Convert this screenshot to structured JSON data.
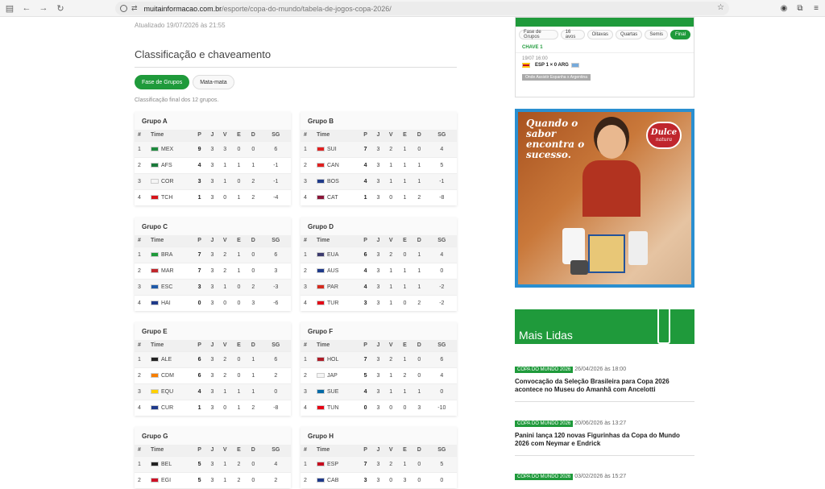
{
  "browser": {
    "url_host": "muitainformacao.com.br",
    "url_path": "/esporte/copa-do-mundo/tabela-de-jogos-copa-2026/"
  },
  "updated": "Atualizado 19/07/2026 às 21:55",
  "section_title": "Classificação e chaveamento",
  "toggle": {
    "groups_label": "Fase de Grupos",
    "knockout_label": "Mata-mata"
  },
  "subtext": "Classificação final dos 12 grupos.",
  "table_headers": {
    "pos": "#",
    "team": "Time",
    "p": "P",
    "j": "J",
    "v": "V",
    "e": "E",
    "d": "D",
    "sg": "SG"
  },
  "groups": [
    {
      "title": "Grupo A",
      "rows": [
        {
          "pos": "1",
          "team": "MEX",
          "p": "9",
          "j": "3",
          "v": "3",
          "e": "0",
          "d": "0",
          "sg": "6"
        },
        {
          "pos": "2",
          "team": "AFS",
          "p": "4",
          "j": "3",
          "v": "1",
          "e": "1",
          "d": "1",
          "sg": "-1"
        },
        {
          "pos": "3",
          "team": "COR",
          "p": "3",
          "j": "3",
          "v": "1",
          "e": "0",
          "d": "2",
          "sg": "-1"
        },
        {
          "pos": "4",
          "team": "TCH",
          "p": "1",
          "j": "3",
          "v": "0",
          "e": "1",
          "d": "2",
          "sg": "-4"
        }
      ]
    },
    {
      "title": "Grupo B",
      "rows": [
        {
          "pos": "1",
          "team": "SUI",
          "p": "7",
          "j": "3",
          "v": "2",
          "e": "1",
          "d": "0",
          "sg": "4"
        },
        {
          "pos": "2",
          "team": "CAN",
          "p": "4",
          "j": "3",
          "v": "1",
          "e": "1",
          "d": "1",
          "sg": "5"
        },
        {
          "pos": "3",
          "team": "BOS",
          "p": "4",
          "j": "3",
          "v": "1",
          "e": "1",
          "d": "1",
          "sg": "-1"
        },
        {
          "pos": "4",
          "team": "CAT",
          "p": "1",
          "j": "3",
          "v": "0",
          "e": "1",
          "d": "2",
          "sg": "-8"
        }
      ]
    },
    {
      "title": "Grupo C",
      "rows": [
        {
          "pos": "1",
          "team": "BRA",
          "p": "7",
          "j": "3",
          "v": "2",
          "e": "1",
          "d": "0",
          "sg": "6"
        },
        {
          "pos": "2",
          "team": "MAR",
          "p": "7",
          "j": "3",
          "v": "2",
          "e": "1",
          "d": "0",
          "sg": "3"
        },
        {
          "pos": "3",
          "team": "ESC",
          "p": "3",
          "j": "3",
          "v": "1",
          "e": "0",
          "d": "2",
          "sg": "-3"
        },
        {
          "pos": "4",
          "team": "HAI",
          "p": "0",
          "j": "3",
          "v": "0",
          "e": "0",
          "d": "3",
          "sg": "-6"
        }
      ]
    },
    {
      "title": "Grupo D",
      "rows": [
        {
          "pos": "1",
          "team": "EUA",
          "p": "6",
          "j": "3",
          "v": "2",
          "e": "0",
          "d": "1",
          "sg": "4"
        },
        {
          "pos": "2",
          "team": "AUS",
          "p": "4",
          "j": "3",
          "v": "1",
          "e": "1",
          "d": "1",
          "sg": "0"
        },
        {
          "pos": "3",
          "team": "PAR",
          "p": "4",
          "j": "3",
          "v": "1",
          "e": "1",
          "d": "1",
          "sg": "-2"
        },
        {
          "pos": "4",
          "team": "TUR",
          "p": "3",
          "j": "3",
          "v": "1",
          "e": "0",
          "d": "2",
          "sg": "-2"
        }
      ]
    },
    {
      "title": "Grupo E",
      "rows": [
        {
          "pos": "1",
          "team": "ALE",
          "p": "6",
          "j": "3",
          "v": "2",
          "e": "0",
          "d": "1",
          "sg": "6"
        },
        {
          "pos": "2",
          "team": "CDM",
          "p": "6",
          "j": "3",
          "v": "2",
          "e": "0",
          "d": "1",
          "sg": "2"
        },
        {
          "pos": "3",
          "team": "EQU",
          "p": "4",
          "j": "3",
          "v": "1",
          "e": "1",
          "d": "1",
          "sg": "0"
        },
        {
          "pos": "4",
          "team": "CUR",
          "p": "1",
          "j": "3",
          "v": "0",
          "e": "1",
          "d": "2",
          "sg": "-8"
        }
      ]
    },
    {
      "title": "Grupo F",
      "rows": [
        {
          "pos": "1",
          "team": "HOL",
          "p": "7",
          "j": "3",
          "v": "2",
          "e": "1",
          "d": "0",
          "sg": "6"
        },
        {
          "pos": "2",
          "team": "JAP",
          "p": "5",
          "j": "3",
          "v": "1",
          "e": "2",
          "d": "0",
          "sg": "4"
        },
        {
          "pos": "3",
          "team": "SUE",
          "p": "4",
          "j": "3",
          "v": "1",
          "e": "1",
          "d": "1",
          "sg": "0"
        },
        {
          "pos": "4",
          "team": "TUN",
          "p": "0",
          "j": "3",
          "v": "0",
          "e": "0",
          "d": "3",
          "sg": "-10"
        }
      ]
    },
    {
      "title": "Grupo G",
      "rows": [
        {
          "pos": "1",
          "team": "BEL",
          "p": "5",
          "j": "3",
          "v": "1",
          "e": "2",
          "d": "0",
          "sg": "4"
        },
        {
          "pos": "2",
          "team": "EGI",
          "p": "5",
          "j": "3",
          "v": "1",
          "e": "2",
          "d": "0",
          "sg": "2"
        }
      ]
    },
    {
      "title": "Grupo H",
      "rows": [
        {
          "pos": "1",
          "team": "ESP",
          "p": "7",
          "j": "3",
          "v": "2",
          "e": "1",
          "d": "0",
          "sg": "5"
        },
        {
          "pos": "2",
          "team": "CAB",
          "p": "3",
          "j": "3",
          "v": "0",
          "e": "3",
          "d": "0",
          "sg": "0"
        }
      ]
    }
  ],
  "flag_colors": {
    "MEX": "#1e8a3e",
    "AFS": "#1a7a3a",
    "COR": "#f5f5f5",
    "TCH": "#d7141a",
    "SUI": "#e02020",
    "CAN": "#e02020",
    "BOS": "#1f3a8a",
    "CAT": "#8a1538",
    "BRA": "#1f9a3b",
    "MAR": "#c1272d",
    "ESC": "#1f5aa8",
    "HAI": "#1f3a8a",
    "EUA": "#3c3b6e",
    "AUS": "#1f3a8a",
    "PAR": "#d52b1e",
    "TUR": "#e30a17",
    "ALE": "#222222",
    "CDM": "#f77f00",
    "EQU": "#ffd100",
    "CUR": "#1f3a8a",
    "HOL": "#ae1c28",
    "JAP": "#f5f5f5",
    "SUE": "#006aa7",
    "TUN": "#e70013",
    "BEL": "#222222",
    "EGI": "#ce1126",
    "ESP": "#c60b1e",
    "CAB": "#1f3a8a"
  },
  "bracket": {
    "tabs": [
      "Fase de Grupos",
      "16 avos",
      "Oitavas",
      "Quartas",
      "Semis",
      "Final"
    ],
    "chave": "CHAVE 1",
    "match_meta": "19/07  16:00",
    "match_line": "ESP  1 × 0  ARG",
    "note": "Onde Assistir Espanha x Argentina"
  },
  "ad": {
    "tagline": "Quando o sabor encontra o sucesso.",
    "brand": "Dulce",
    "brand_sub": "natura"
  },
  "mais_lidas": {
    "title": "Mais Lidas",
    "items": [
      {
        "tag": "COPA DO MUNDO 2026",
        "date": "26/04/2026 às 18:00",
        "headline": "Convocação da Seleção Brasileira para Copa 2026 acontece no Museu do Amanhã com Ancelotti"
      },
      {
        "tag": "COPA DO MUNDO 2026",
        "date": "20/06/2026 às 13:27",
        "headline": "Panini lança 120 novas Figurinhas da Copa do Mundo 2026 com Neymar e Endrick"
      },
      {
        "tag": "COPA DO MUNDO 2026",
        "date": "03/02/2026 às 15:27",
        "headline": ""
      }
    ]
  }
}
